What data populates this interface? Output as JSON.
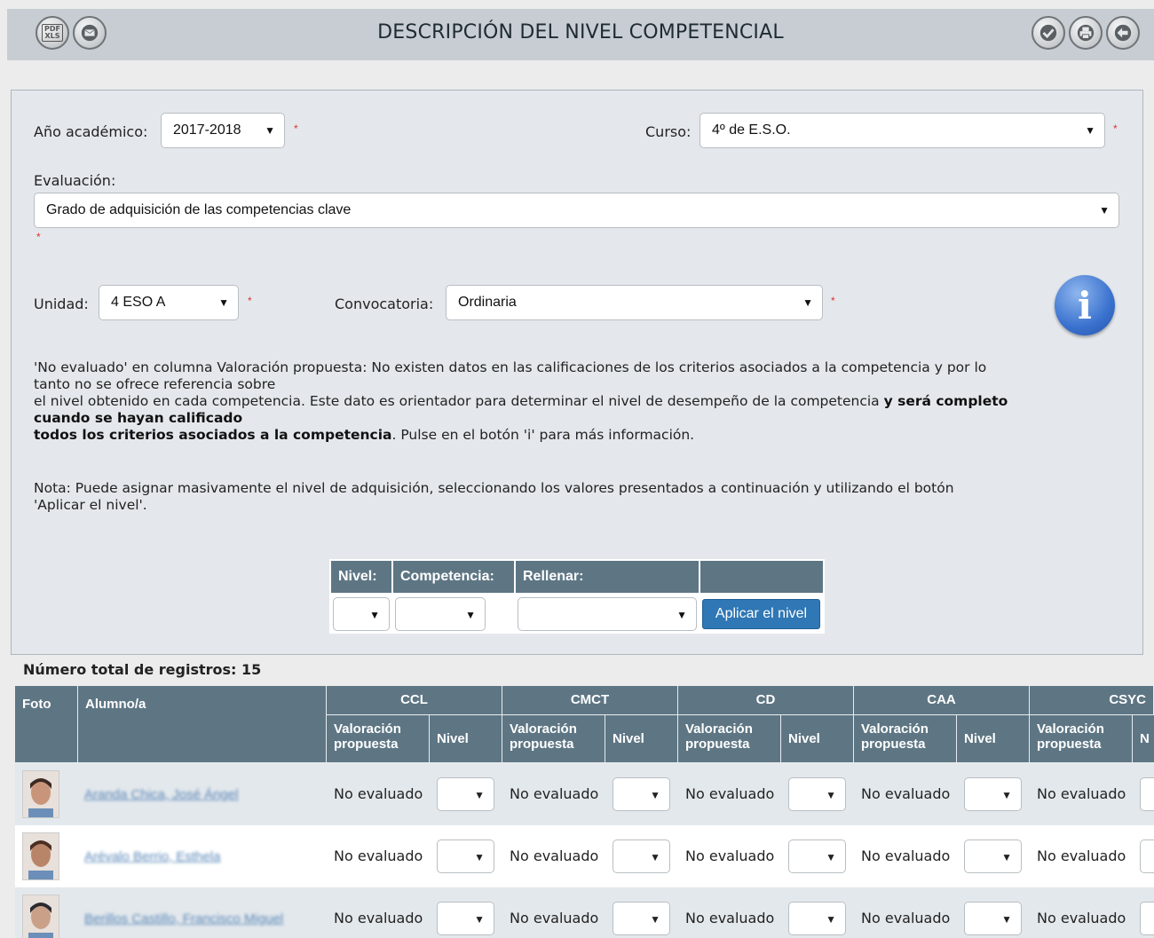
{
  "header": {
    "title": "DESCRIPCIÓN DEL NIVEL COMPETENCIAL",
    "left_icons": [
      "pdf-xls-export-icon",
      "mail-icon"
    ],
    "right_icons": [
      "check-icon",
      "print-icon",
      "back-arrow-icon"
    ],
    "pdf_label_top": "PDF",
    "pdf_label_bottom": "XLS"
  },
  "form": {
    "year_label": "Año académico:",
    "year_value": "2017-2018",
    "course_label": "Curso:",
    "course_value": "4º de E.S.O.",
    "evaluation_label": "Evaluación:",
    "evaluation_value": "Grado de adquisición de las competencias clave",
    "unit_label": "Unidad:",
    "unit_value": "4 ESO A",
    "call_label": "Convocatoria:",
    "call_value": "Ordinaria",
    "required_mark": "*",
    "dropdown_arrow": "▼",
    "info_icon_glyph": "i"
  },
  "notes": {
    "p1_line1": "'No evaluado' en columna Valoración propuesta:  No existen datos en las calificaciones de los criterios asociados a la competencia y por lo",
    "p1_line2": "tanto no se ofrece referencia sobre",
    "p1_line3": "el nivel obtenido en cada competencia. Este dato es orientador para determinar el nivel de desempeño de la competencia ",
    "p1_bold1": "y será completo",
    "p1_bold2": "cuando se hayan calificado",
    "p1_bold3": "todos los criterios asociados a la competencia",
    "p1_tail": ". Pulse en el botón 'i' para más información.",
    "p2_line1": "Nota:  Puede asignar masivamente el nivel de adquisición, seleccionando los valores presentados a continuación y utilizando el botón",
    "p2_line2": "'Aplicar el nivel'."
  },
  "mass_assign": {
    "nivel_header": "Nivel:",
    "competencia_header": "Competencia:",
    "rellenar_header": "Rellenar:",
    "apply_button": "Aplicar el nivel"
  },
  "total_records": "Número total de registros: 15",
  "table": {
    "photo_header": "Foto",
    "student_header": "Alumno/a",
    "competencies": [
      "CCL",
      "CMCT",
      "CD",
      "CAA",
      "CSYC"
    ],
    "valoracion_line1": "Valoración",
    "valoracion_line2": "propuesta",
    "nivel_header": "Nivel",
    "last_nivel_partial": "N",
    "rows": [
      {
        "student": "Aranda Chica, José Ángel",
        "values": [
          "No evaluado",
          "No evaluado",
          "No evaluado",
          "No evaluado",
          "No evaluado"
        ]
      },
      {
        "student": "Arévalo Berrio, Esthela",
        "values": [
          "No evaluado",
          "No evaluado",
          "No evaluado",
          "No evaluado",
          "No evaluado"
        ]
      },
      {
        "student": "Berillos Castillo, Francisco Miguel",
        "values": [
          "No evaluado",
          "No evaluado",
          "No evaluado",
          "No evaluado",
          "No evaluado"
        ]
      }
    ]
  },
  "colors": {
    "header_bg": "#5e7684",
    "row_alt": "#e3e8ec",
    "link": "#5a87b8",
    "apply_button": "#2f77b5",
    "required": "#e03030"
  }
}
